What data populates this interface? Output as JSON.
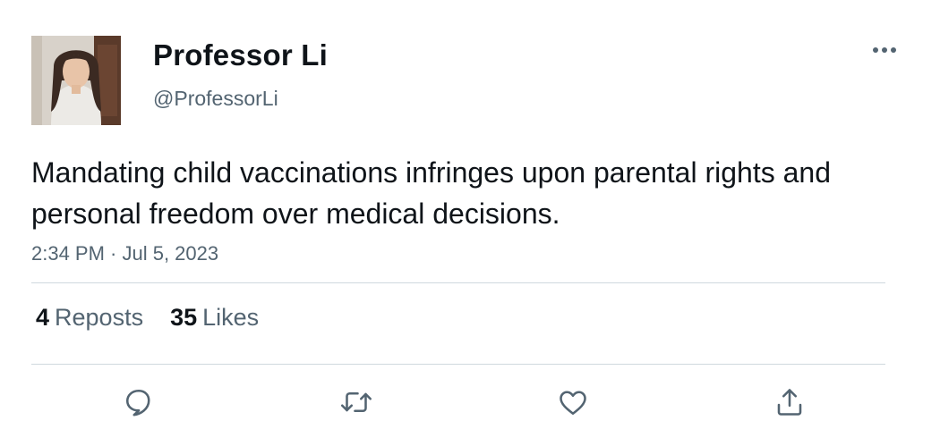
{
  "user": {
    "display_name": "Professor Li",
    "handle": "@ProfessorLi"
  },
  "tweet": {
    "text": "Mandating child vaccinations infringes upon parental rights and personal freedom over medical decisions.",
    "timestamp": "2:34 PM · Jul 5, 2023"
  },
  "stats": {
    "reposts_count": "4",
    "reposts_label": "Reposts",
    "likes_count": "35",
    "likes_label": "Likes"
  },
  "icons": {
    "more": "more-horizontal-icon",
    "reply": "reply-icon",
    "repost": "repost-icon",
    "like": "heart-icon",
    "share": "share-icon"
  },
  "colors": {
    "text": "#0f1419",
    "secondary": "#536471",
    "divider": "#cfd9de"
  }
}
